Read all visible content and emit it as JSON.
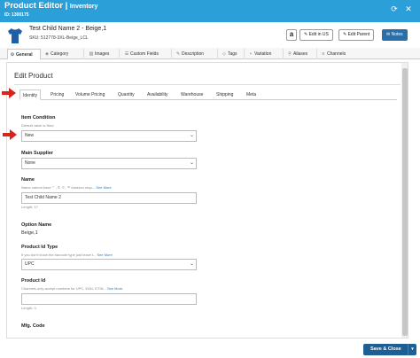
{
  "titlebar": {
    "title": "Product Editor |",
    "subtitle": "Inventory",
    "id_label": "ID: 1300175"
  },
  "product": {
    "name": "Test Child Name 2 - Beige,1",
    "sku": "SKU: 512778-3XL-Beige_LCL",
    "amazon_glyph": "a",
    "buttons": {
      "edit_us": "Edit in US",
      "edit_parent": "Edit Parent",
      "notes": "Notes"
    }
  },
  "main_tabs": [
    {
      "label": "General",
      "icon": "gear-icon",
      "glyph": "⚙"
    },
    {
      "label": "Category",
      "icon": "tag-icon",
      "glyph": "◈"
    },
    {
      "label": "Images",
      "icon": "image-icon",
      "glyph": "▨"
    },
    {
      "label": "Custom Fields",
      "icon": "list-icon",
      "glyph": "☰"
    },
    {
      "label": "Description",
      "icon": "chat-icon",
      "glyph": "✎"
    },
    {
      "label": "Tags",
      "icon": "tags-icon",
      "glyph": "◇"
    },
    {
      "label": "Variation",
      "icon": "branch-icon",
      "glyph": "⑂"
    },
    {
      "label": "Aliases",
      "icon": "link-icon",
      "glyph": "⚲"
    },
    {
      "label": "Channels",
      "icon": "cart-icon",
      "glyph": "≡"
    }
  ],
  "panel": {
    "title": "Edit Product"
  },
  "sub_tabs": [
    "Identity",
    "Pricing",
    "Volume Pricing",
    "Quantity",
    "Availability",
    "Warehouse",
    "Shipping",
    "Meta"
  ],
  "form": {
    "item_condition": {
      "label": "Item Condition",
      "help": "Default value is New",
      "value": "New"
    },
    "main_supplier": {
      "label": "Main Supplier",
      "value": "None"
    },
    "name": {
      "label": "Name",
      "help": "Name cannot have \"\" ,  ®, ©, ™ Amazon requ...",
      "help_link": "See More",
      "value": "Test Child Name 2",
      "length": "Length: 17"
    },
    "option_name": {
      "label": "Option Name",
      "value": "Beige,1"
    },
    "product_id_type": {
      "label": "Product Id Type",
      "help": "If you don't know the barcode type just leave t...",
      "help_link": "See More",
      "value": "UPC"
    },
    "product_id": {
      "label": "Product Id",
      "help": "Channels only accept numbers for UPC, EAN, GTIN...",
      "help_link": "See More",
      "value": "",
      "length": "Length: 0"
    },
    "mfg_code": {
      "label": "Mfg. Code"
    }
  },
  "footer": {
    "save_label": "Save & Close",
    "caret": "▾"
  },
  "colors": {
    "titlebar": "#2a9fd8",
    "notes_button": "#2a6fa8",
    "save_button": "#1d5f94",
    "arrow": "#d9231d",
    "shirt": "#1f5fa8"
  }
}
